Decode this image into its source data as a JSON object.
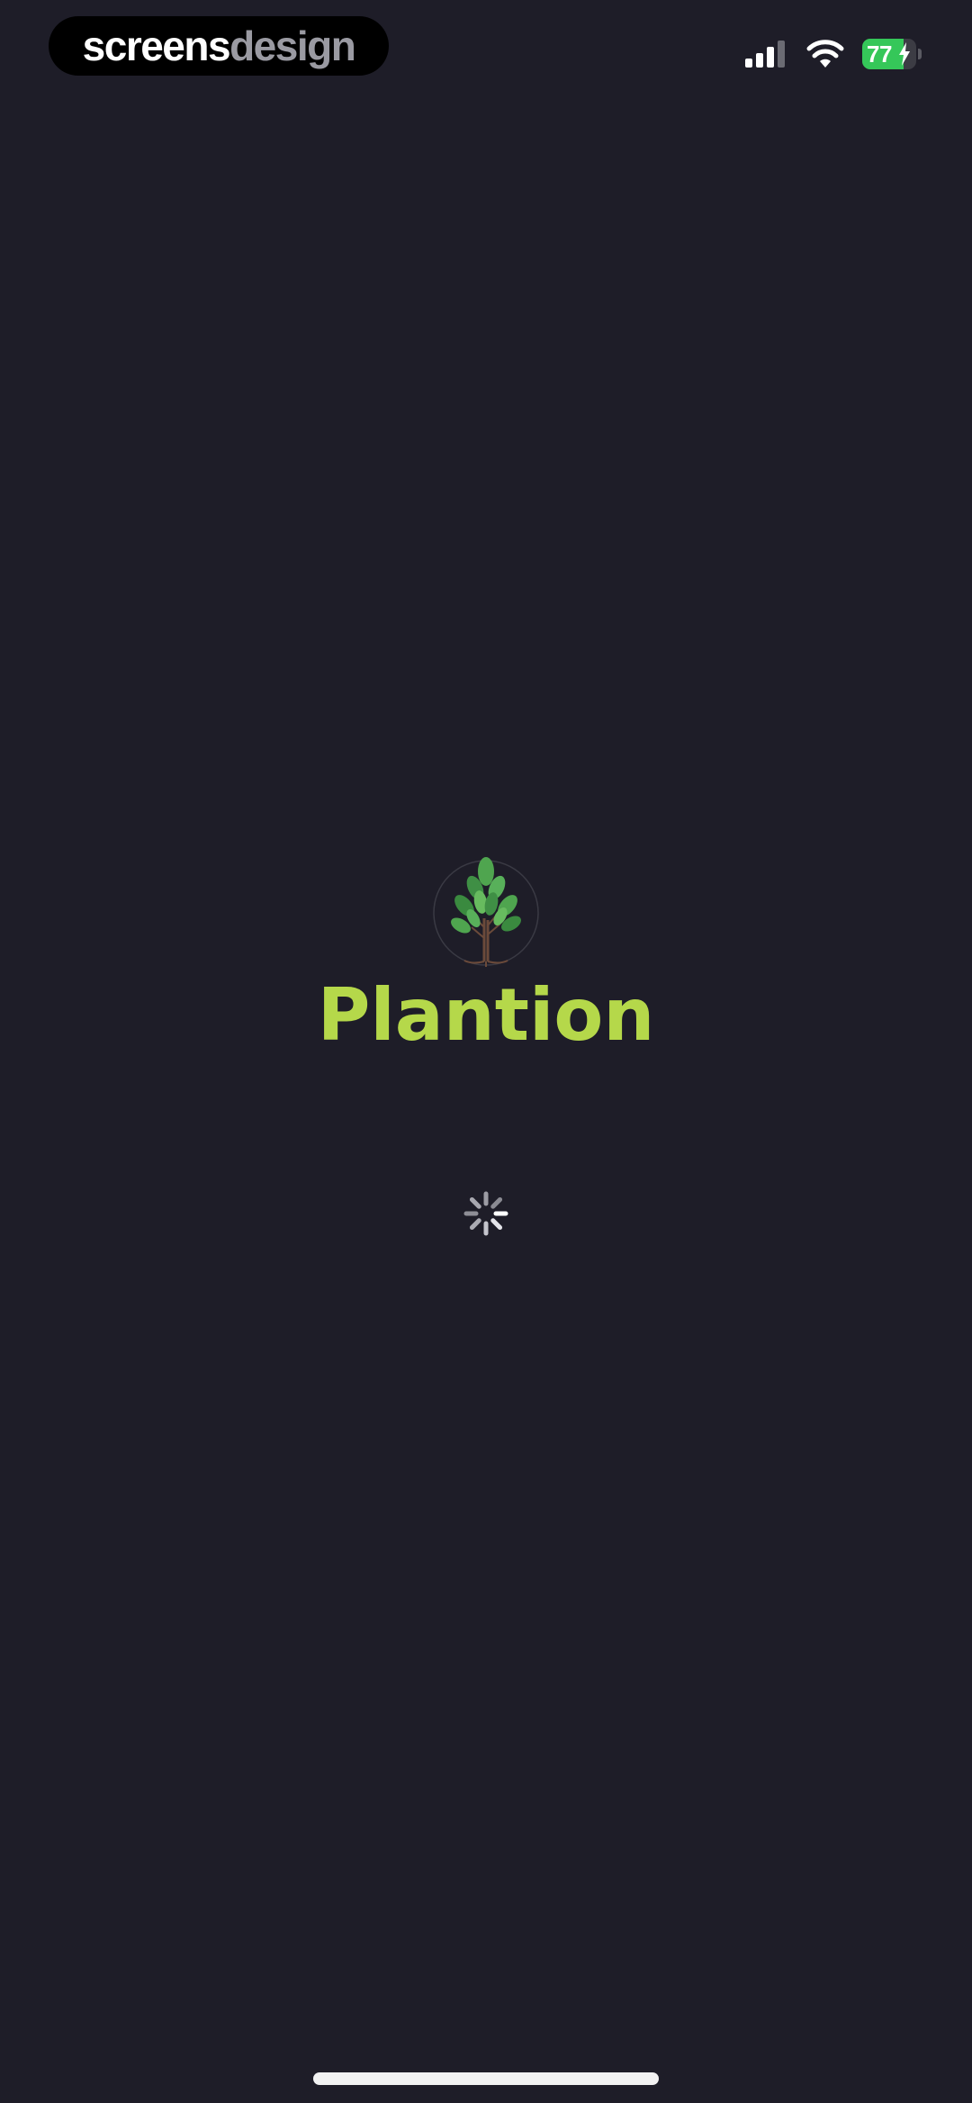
{
  "brand": {
    "part1": "screens",
    "part2": "design"
  },
  "status_bar": {
    "battery_level": "77",
    "battery_fraction": 0.77,
    "icons": [
      "cellular-signal-icon",
      "wifi-icon",
      "battery-icon",
      "charging-bolt-icon"
    ]
  },
  "splash": {
    "app_name": "Plantion",
    "logo_icon": "tree-logo-icon",
    "loading_indicator": "loading-spinner-icon"
  },
  "colors": {
    "background": "#1e1d28",
    "app_name": "#b5d84a",
    "battery": "#35c759"
  }
}
